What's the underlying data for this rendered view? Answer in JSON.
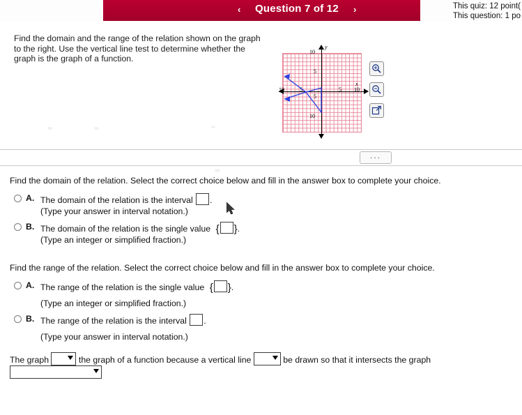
{
  "header": {
    "question_title": "Question 7 of 12",
    "prev_icon": "chevron-left-icon",
    "next_icon": "chevron-right-icon",
    "quiz_points": "This quiz: 12 point(",
    "question_points": "This question: 1 po"
  },
  "question": {
    "text": "Find the domain and the range of the relation shown on the graph to the right. Use the vertical line test to determine whether the graph is the graph of a function.",
    "graph": {
      "x_label": "x",
      "y_label": "y",
      "ticks": {
        "y_top": "10",
        "y_upper_mid": "5",
        "y_lower_mid": "5",
        "y_bottom": "10",
        "x_left_far": "10",
        "x_left_mid": "5",
        "x_right_mid": "5",
        "x_right_far": "10"
      }
    },
    "tools": [
      {
        "name": "zoom-in-icon",
        "label": "Q"
      },
      {
        "name": "zoom-out-icon",
        "label": "Q"
      },
      {
        "name": "open-popup-icon",
        "label": "open"
      }
    ],
    "more_options": "..."
  },
  "domain_section": {
    "prompt": "Find the domain of the relation. Select the correct choice below and fill in the answer box to complete your choice.",
    "choices": [
      {
        "letter": "A.",
        "text_before": "The domain of the relation is the interval",
        "text_after": ".",
        "sub": "(Type your answer in interval notation.)",
        "input_type": "box"
      },
      {
        "letter": "B.",
        "text_before": "The domain of the relation is the single value",
        "text_after": ".",
        "sub": "(Type an integer or simplified fraction.)",
        "input_type": "brace-box"
      }
    ]
  },
  "range_section": {
    "prompt": "Find the range of the relation. Select the correct choice below and fill in the answer box to complete your choice.",
    "choices": [
      {
        "letter": "A.",
        "text_before": "The range of the relation is the single value",
        "text_after": ".",
        "sub": "(Type an integer or simplified fraction.)",
        "input_type": "brace-box"
      },
      {
        "letter": "B.",
        "text_before": "The range of the relation is the interval",
        "text_after": ".",
        "sub": "(Type your answer in interval notation.)",
        "input_type": "box"
      }
    ]
  },
  "bottom": {
    "part1": "The graph",
    "part2": "the graph of a function because a vertical line",
    "part3": "be drawn so that it intersects the graph",
    "dropdown1_value": "",
    "dropdown2_value": "",
    "dropdown3_value": ""
  }
}
